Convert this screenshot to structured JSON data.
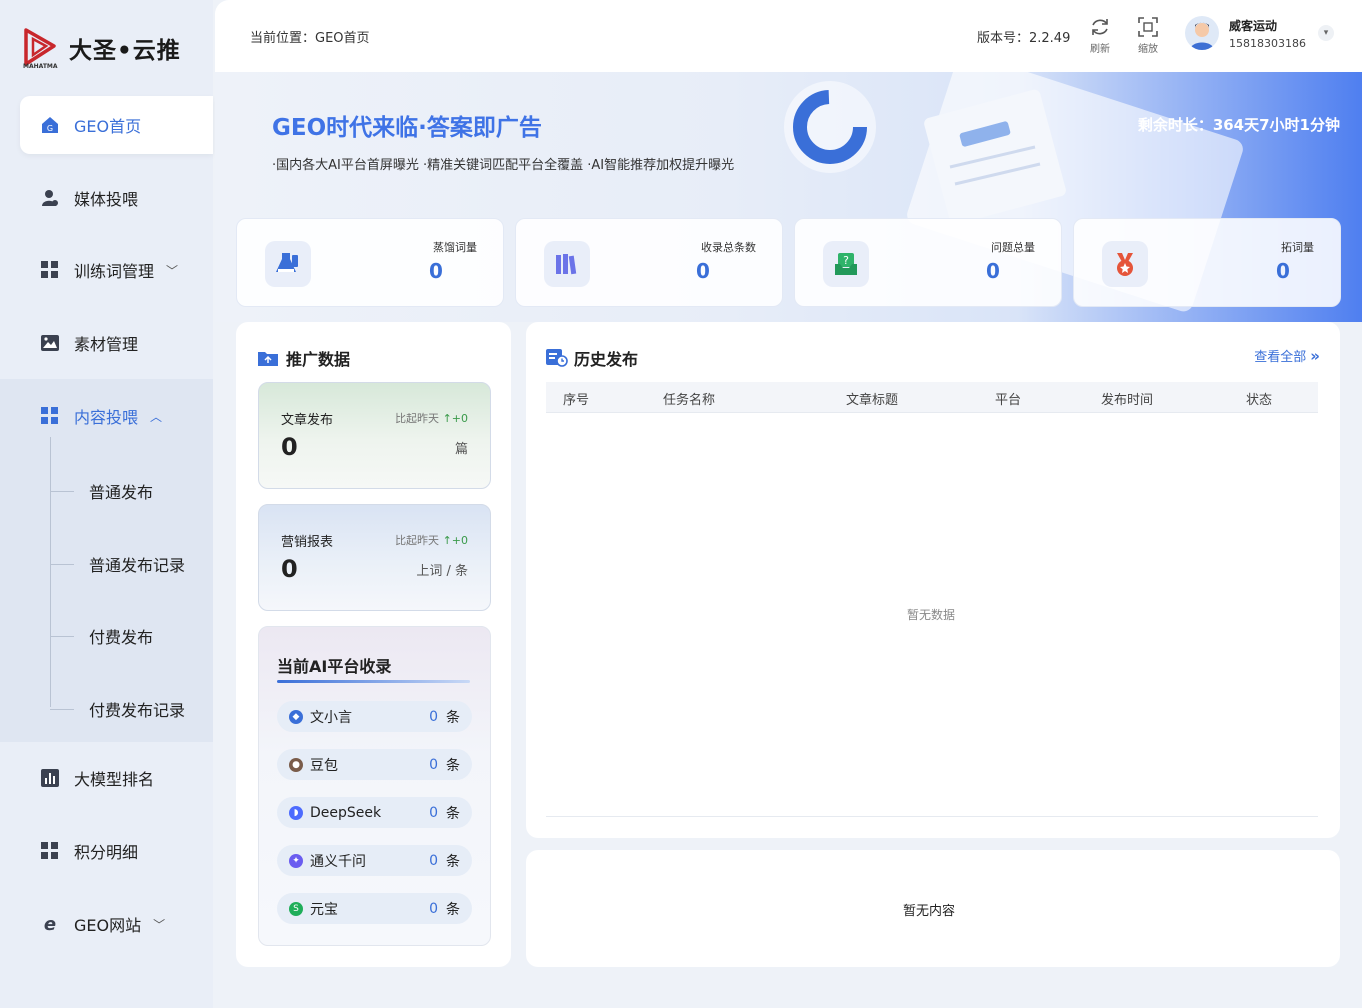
{
  "brand": {
    "name": "大圣•云推",
    "sub": "MAHATMA"
  },
  "sidebar": {
    "items": [
      {
        "label": "GEO首页",
        "icon": "home-icon"
      },
      {
        "label": "媒体投喂",
        "icon": "user-icon"
      },
      {
        "label": "训练词管理",
        "icon": "grid-icon"
      },
      {
        "label": "素材管理",
        "icon": "image-icon"
      },
      {
        "label": "内容投喂",
        "icon": "grid-icon"
      },
      {
        "label": "大模型排名",
        "icon": "chart-icon"
      },
      {
        "label": "积分明细",
        "icon": "grid-icon"
      },
      {
        "label": "GEO网站",
        "icon": "ie-icon"
      }
    ],
    "subitems": [
      "普通发布",
      "普通发布记录",
      "付费发布",
      "付费发布记录"
    ]
  },
  "topbar": {
    "breadcrumb": "当前位置：GEO首页",
    "version": "版本号：2.2.49",
    "refresh_label": "刷新",
    "zoom_label": "缩放",
    "user_name": "威客运动",
    "user_phone": "15818303186"
  },
  "banner": {
    "title": "GEO时代来临·答案即广告",
    "subtitle": "·国内各大AI平台首屏曝光 ·精准关键词匹配平台全覆盖 ·AI智能推荐加权提升曝光",
    "remaining": "剩余时长：364天7小时1分钟"
  },
  "stats": [
    {
      "label": "蒸馏词量",
      "value": "0"
    },
    {
      "label": "收录总条数",
      "value": "0"
    },
    {
      "label": "问题总量",
      "value": "0"
    },
    {
      "label": "拓词量",
      "value": "0"
    }
  ],
  "promo": {
    "title": "推广数据",
    "article": {
      "label": "文章发布",
      "compare": "比起昨天",
      "delta": "+0",
      "value": "0",
      "unit": "篇"
    },
    "report": {
      "label": "营销报表",
      "compare": "比起昨天",
      "delta": "+0",
      "value": "0",
      "unit": "上词 / 条"
    },
    "ai_title": "当前AI平台收录",
    "platforms": [
      {
        "name": "文小言",
        "count": "0",
        "unit": "条",
        "color": "#3a6fd8"
      },
      {
        "name": "豆包",
        "count": "0",
        "unit": "条",
        "color": "#7a5c4a"
      },
      {
        "name": "DeepSeek",
        "count": "0",
        "unit": "条",
        "color": "#4d6bfe"
      },
      {
        "name": "通义千问",
        "count": "0",
        "unit": "条",
        "color": "#6a5cf0"
      },
      {
        "name": "元宝",
        "count": "0",
        "unit": "条",
        "color": "#1fae5a"
      }
    ]
  },
  "history": {
    "title": "历史发布",
    "view_all": "查看全部",
    "columns": [
      "序号",
      "任务名称",
      "文章标题",
      "平台",
      "发布时间",
      "状态"
    ],
    "empty": "暂无数据"
  },
  "bottom": {
    "empty": "暂无内容"
  }
}
